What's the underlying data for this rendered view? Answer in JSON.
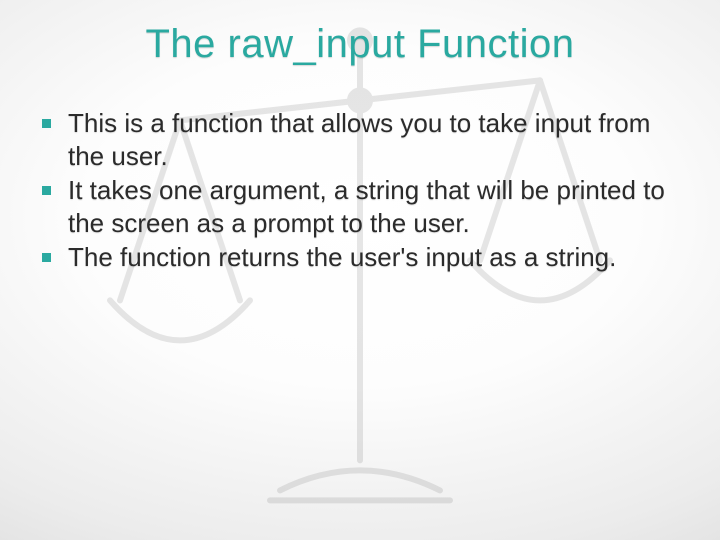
{
  "title": "The raw_input Function",
  "bullets": [
    "This is a function that allows you to take input from the user.",
    "It takes one argument, a string that will be printed to the screen as a prompt to the user.",
    "The function returns the user's input as a string."
  ],
  "colors": {
    "accent": "#2aa9a0"
  }
}
